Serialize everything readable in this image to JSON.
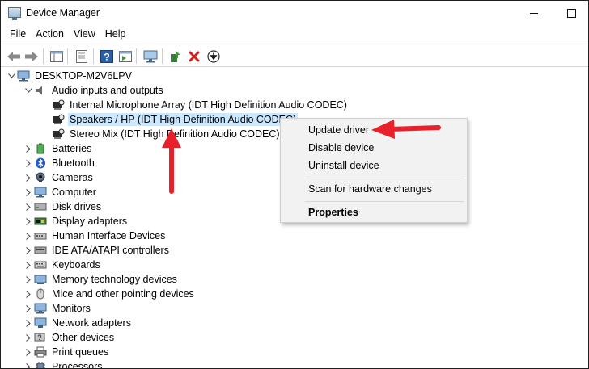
{
  "window": {
    "title": "Device Manager"
  },
  "menu": [
    "File",
    "Action",
    "View",
    "Help"
  ],
  "tree": {
    "computer": "DESKTOP-M2V6LPV",
    "audio_category": "Audio inputs and outputs",
    "audio_devices": [
      "Internal Microphone Array (IDT High Definition Audio CODEC)",
      "Speakers / HP (IDT High Definition Audio CODEC)",
      "Stereo Mix (IDT High Definition Audio CODEC)"
    ],
    "categories": [
      "Batteries",
      "Bluetooth",
      "Cameras",
      "Computer",
      "Disk drives",
      "Display adapters",
      "Human Interface Devices",
      "IDE ATA/ATAPI controllers",
      "Keyboards",
      "Memory technology devices",
      "Mice and other pointing devices",
      "Monitors",
      "Network adapters",
      "Other devices",
      "Print queues",
      "Processors"
    ]
  },
  "context_menu": {
    "update_driver": "Update driver",
    "disable_device": "Disable device",
    "uninstall_device": "Uninstall device",
    "scan_hardware": "Scan for hardware changes",
    "properties": "Properties"
  },
  "colors": {
    "selection": "#cce8ff",
    "annotation_arrow": "#e8202a",
    "menu_bg": "#f2f2f2"
  }
}
